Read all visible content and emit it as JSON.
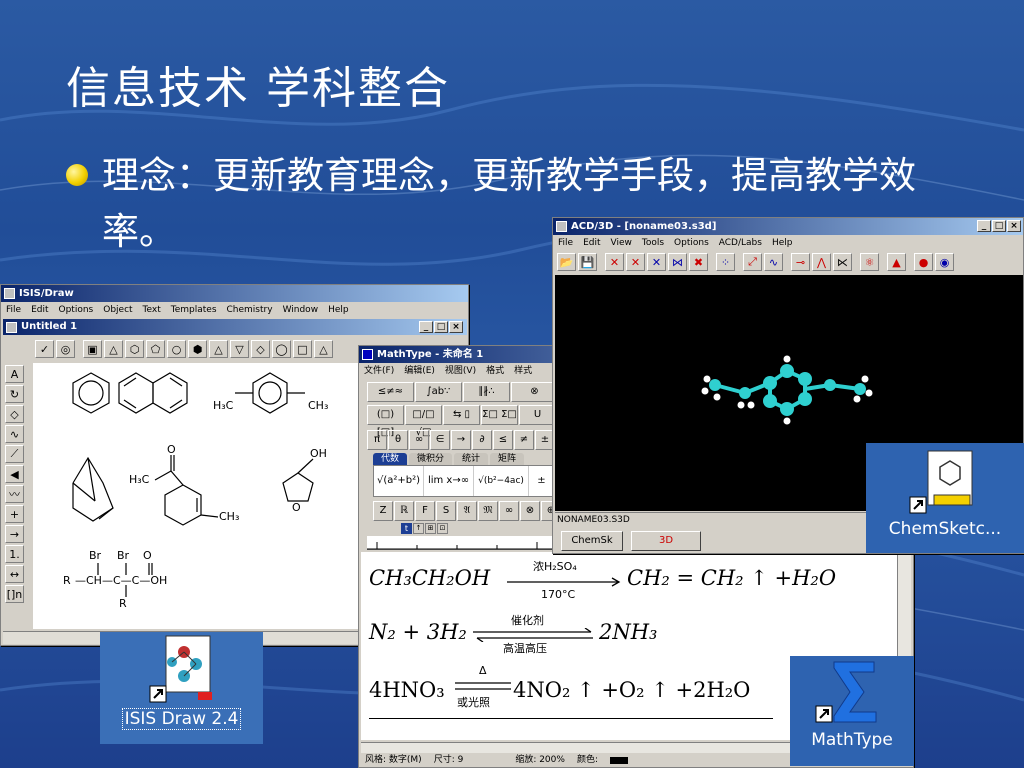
{
  "slide": {
    "title": "信息技术  学科整合",
    "bullet": "理念：更新教育理念，更新教学手段，提高教学效率。"
  },
  "isis": {
    "window_title": "ISIS/Draw",
    "menu": [
      "File",
      "Edit",
      "Options",
      "Object",
      "Text",
      "Templates",
      "Chemistry",
      "Window",
      "Help"
    ],
    "doc_title": "Untitled 1",
    "labels": {
      "h3c": "H₃C",
      "ch3": "CH₃",
      "h3c2": "H₃C",
      "o": "O",
      "ch3b": "CH₃",
      "oh": "OH",
      "o2": "O",
      "br1": "Br",
      "br2": "Br",
      "o3": "O",
      "r1": "R",
      "chain": "—CH—C—C—OH",
      "r2": "R"
    },
    "left_tools": [
      "A",
      "↻",
      "◇",
      "∿",
      "⟋",
      "◀",
      "〰",
      "+",
      "→",
      "1.",
      "↔",
      "[]n"
    ]
  },
  "acd": {
    "window_title": "ACD/3D - [noname03.s3d]",
    "menu": [
      "File",
      "Edit",
      "View",
      "Tools",
      "Options",
      "ACD/Labs",
      "Help"
    ],
    "status": "NONAME03.S3D",
    "tab1": "ChemSk",
    "tab2": "3D"
  },
  "mathtype": {
    "window_title": "MathType - 未命名 1",
    "menu": [
      "文件(F)",
      "编辑(E)",
      "视图(V)",
      "格式",
      "样式"
    ],
    "row1": [
      "≤≠≈",
      "∫ab∵",
      "∥∦∴",
      "⊗"
    ],
    "row2": [
      "(□) [□]",
      "□/□ √□",
      "⇆ ▯",
      "Σ□ Σ□",
      "U"
    ],
    "row3": [
      "π",
      "θ",
      "∞",
      "∈",
      "→",
      "∂",
      "≤",
      "≠",
      "±"
    ],
    "tabs": [
      "代数",
      "微积分",
      "统计",
      "矩阵"
    ],
    "row4": [
      "√(a²+b²)",
      "lim x→∞",
      "√(b²−4ac)",
      "±"
    ],
    "row5": [
      "Z",
      "ℝ",
      "F",
      "S",
      "𝔄",
      "𝔐",
      "∞",
      "⊗",
      "⊕"
    ],
    "statusbar": [
      "风格: 数字(M)",
      "尺寸: 9",
      "缩放: 200%",
      "颜色:"
    ],
    "eq1": {
      "left": "CH₃CH₂OH",
      "top": "浓H₂SO₄",
      "bottom": "170°C",
      "right": "CH₂ = CH₂ ↑ +H₂O"
    },
    "eq2": {
      "left": "N₂ + 3H₂",
      "top": "催化剂",
      "bottom": "高温高压",
      "right": "2NH₃"
    },
    "eq3": {
      "left": "4HNO₃",
      "top": "Δ",
      "bottom": "或光照",
      "right": "4NO₂ ↑ +O₂ ↑ +2H₂O"
    }
  },
  "desktop": {
    "isis_icon": "ISIS Draw 2.4",
    "chemsketch_icon": "ChemSketc...",
    "mathtype_icon": "MathType"
  }
}
